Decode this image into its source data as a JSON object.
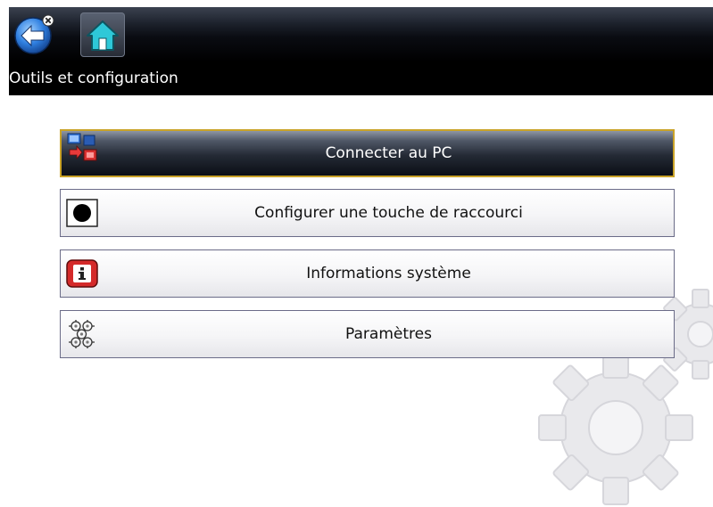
{
  "header": {
    "back_icon": "back-arrow-icon",
    "home_icon": "home-icon",
    "title": "Outils et configuration"
  },
  "menu": {
    "selected_index": 0,
    "items": [
      {
        "label": "Connecter au PC",
        "icon": "connect-pc-icon",
        "selected": true
      },
      {
        "label": "Configurer une touche de raccourci",
        "icon": "shortcut-key-icon",
        "selected": false
      },
      {
        "label": "Informations système",
        "icon": "system-info-icon",
        "selected": false
      },
      {
        "label": "Paramètres",
        "icon": "settings-icon",
        "selected": false
      }
    ]
  },
  "colors": {
    "selection_border": "#c9a227",
    "item_border": "#6b6c88",
    "info_icon_red": "#d42a2a",
    "back_button_blue": "#2f7fe0",
    "home_icon_teal": "#2ec8d8"
  }
}
